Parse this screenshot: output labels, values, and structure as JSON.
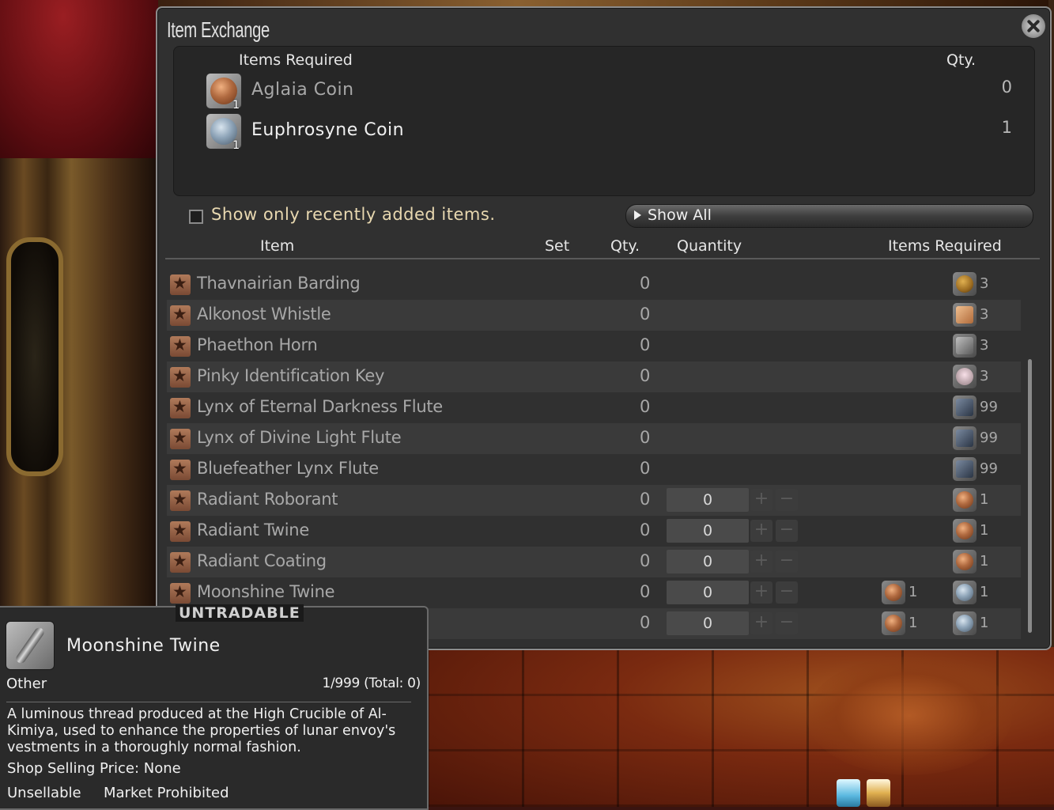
{
  "window": {
    "title": "Item Exchange"
  },
  "required_panel": {
    "header_item": "Items Required",
    "header_qty": "Qty.",
    "items": [
      {
        "name": "Aglaia Coin",
        "count": "1",
        "qty": "0",
        "icon": "aglaia-coin-icon"
      },
      {
        "name": "Euphrosyne Coin",
        "count": "1",
        "qty": "1",
        "icon": "euphrosyne-coin-icon"
      }
    ]
  },
  "filter": {
    "checkbox_label": "Show only recently added items.",
    "checked": false,
    "dropdown_label": "Show All"
  },
  "table": {
    "headers": {
      "item": "Item",
      "set": "Set",
      "qty": "Qty.",
      "quantity": "Quantity",
      "items_required": "Items Required"
    },
    "rows": [
      {
        "name": "Thavnairian Barding",
        "qty": "0",
        "req": [
          {
            "icon": "egg-icon",
            "count": "3"
          }
        ]
      },
      {
        "name": "Alkonost Whistle",
        "qty": "0",
        "req": [
          {
            "icon": "whistle-icon",
            "count": "3"
          }
        ]
      },
      {
        "name": "Phaethon Horn",
        "qty": "0",
        "req": [
          {
            "icon": "horn-icon",
            "count": "3"
          }
        ]
      },
      {
        "name": "Pinky Identification Key",
        "qty": "0",
        "req": [
          {
            "icon": "key-icon",
            "count": "3"
          }
        ]
      },
      {
        "name": "Lynx of Eternal Darkness Flute",
        "qty": "0",
        "req": [
          {
            "icon": "flute-icon",
            "count": "99"
          }
        ]
      },
      {
        "name": "Lynx of Divine Light Flute",
        "qty": "0",
        "req": [
          {
            "icon": "flute-icon",
            "count": "99"
          }
        ]
      },
      {
        "name": "Bluefeather Lynx Flute",
        "qty": "0",
        "req": [
          {
            "icon": "flute-icon",
            "count": "99"
          }
        ]
      },
      {
        "name": "Radiant Roborant",
        "qty": "0",
        "quantity": "0",
        "req": [
          {
            "icon": "aglaia-coin-icon",
            "count": "1"
          }
        ]
      },
      {
        "name": "Radiant Twine",
        "qty": "0",
        "quantity": "0",
        "req": [
          {
            "icon": "aglaia-coin-icon",
            "count": "1"
          }
        ]
      },
      {
        "name": "Radiant Coating",
        "qty": "0",
        "quantity": "0",
        "req": [
          {
            "icon": "aglaia-coin-icon",
            "count": "1"
          }
        ]
      },
      {
        "name": "Moonshine Twine",
        "qty": "0",
        "quantity": "0",
        "req": [
          {
            "icon": "aglaia-coin-icon",
            "count": "1"
          },
          {
            "icon": "euphrosyne-coin-icon",
            "count": "1"
          }
        ]
      },
      {
        "name": "",
        "qty": "0",
        "quantity": "0",
        "req": [
          {
            "icon": "aglaia-coin-icon",
            "count": "1"
          },
          {
            "icon": "euphrosyne-coin-icon",
            "count": "1"
          }
        ]
      }
    ],
    "stepper_plus": "+",
    "stepper_minus": "−"
  },
  "tooltip": {
    "badge": "UNTRADABLE",
    "name": "Moonshine Twine",
    "category": "Other",
    "count": "1/999 (Total: 0)",
    "description": "A luminous thread produced at the High Crucible of Al-Kimiya, used to enhance the properties of lunar envoy's vestments in a thoroughly normal fashion.",
    "price": "Shop Selling Price: None",
    "flag_sell": "Unsellable",
    "flag_market": "Market Prohibited"
  }
}
